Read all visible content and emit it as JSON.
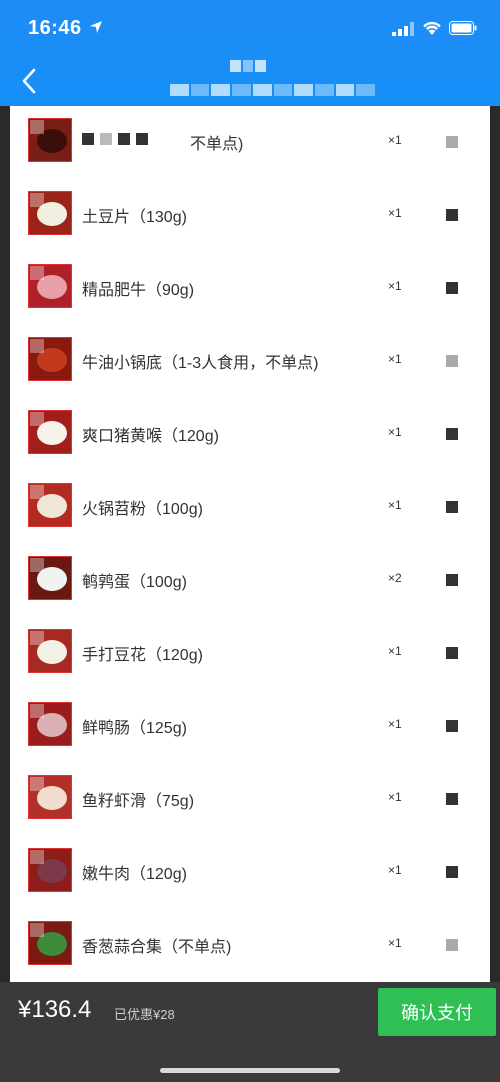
{
  "status_bar": {
    "time": "16:46"
  },
  "header": {
    "back_icon": "chevron-left-icon"
  },
  "items": [
    {
      "name": "不单点)",
      "qty": "×1",
      "thumb_color": "#7a1d14"
    },
    {
      "name": "土豆片（130g)",
      "qty": "×1",
      "thumb_color": "#9a2418"
    },
    {
      "name": "精品肥牛（90g)",
      "qty": "×1",
      "thumb_color": "#b0202a"
    },
    {
      "name": "牛油小锅底（1-3人食用，不单点)",
      "qty": "×1",
      "thumb_color": "#8a1a10"
    },
    {
      "name": "爽口猪黄喉（120g)",
      "qty": "×1",
      "thumb_color": "#a21e1a"
    },
    {
      "name": "火锅苕粉（100g)",
      "qty": "×1",
      "thumb_color": "#b32a22"
    },
    {
      "name": "鹌鹑蛋（100g)",
      "qty": "×2",
      "thumb_color": "#6a1812"
    },
    {
      "name": "手打豆花（120g)",
      "qty": "×1",
      "thumb_color": "#a62a22"
    },
    {
      "name": "鲜鸭肠（125g)",
      "qty": "×1",
      "thumb_color": "#9a1c1c"
    },
    {
      "name": "鱼籽虾滑（75g)",
      "qty": "×1",
      "thumb_color": "#b3302a"
    },
    {
      "name": "嫩牛肉（120g)",
      "qty": "×1",
      "thumb_color": "#8e1c18"
    },
    {
      "name": "香葱蒜合集（不单点)",
      "qty": "×1",
      "thumb_color": "#7a1a12"
    }
  ],
  "footer": {
    "total": "¥136.4",
    "discount": "已优惠¥28",
    "confirm_label": "确认支付"
  }
}
